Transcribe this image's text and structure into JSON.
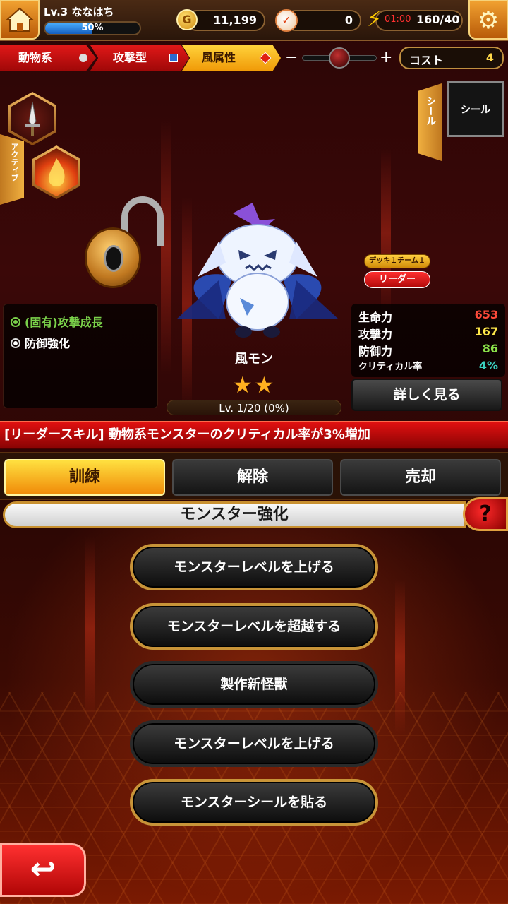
{
  "player": {
    "level_name": "Lv.3 ななはち",
    "xp_percent": 50,
    "xp_label": "50%"
  },
  "currency": {
    "gold": "11,199",
    "gold_icon": "G",
    "gems": "0",
    "stamina_timer": "01:00",
    "stamina": "160/40"
  },
  "filters": [
    {
      "label": "動物系"
    },
    {
      "label": "攻撃型"
    },
    {
      "label": "風属性"
    }
  ],
  "slider": {
    "minus": "−",
    "plus": "+",
    "level": 0.5
  },
  "cost": {
    "label": "コスト",
    "value": "4"
  },
  "side": {
    "active_label": "アクティブ",
    "seal_tab_label": "シール",
    "seal_box_label": "シール"
  },
  "skills": [
    {
      "label": "(固有)攻撃成長",
      "selected": true
    },
    {
      "label": "防御強化",
      "selected": false
    }
  ],
  "monster": {
    "name": "風モン",
    "stars": "★★",
    "level_text": "Lv. 1/20 (0%)"
  },
  "deck": {
    "badge": "デッキ１チーム１",
    "leader": "リーダー"
  },
  "stats": [
    {
      "label": "生命力",
      "value": "653",
      "color": "#ff4a3a"
    },
    {
      "label": "攻撃力",
      "value": "167",
      "color": "#ffe84a"
    },
    {
      "label": "防御力",
      "value": "86",
      "color": "#8ae04a"
    },
    {
      "label": "クリティカル率",
      "value": "4%",
      "color": "#3ad0c0"
    }
  ],
  "details_button": "詳しく見る",
  "leader_skill": "[リーダースキル] 動物系モンスターのクリティカル率が3%増加",
  "tabs": [
    {
      "label": "訓練",
      "active": true
    },
    {
      "label": "解除",
      "active": false
    },
    {
      "label": "売却",
      "active": false
    }
  ],
  "section_title": "モンスター強化",
  "help_label": "?",
  "actions": [
    {
      "label": "モンスターレベルを上げる"
    },
    {
      "label": "モンスターレベルを超越する"
    },
    {
      "label": "製作新怪獸"
    },
    {
      "label": "モンスターレベルを上げる"
    },
    {
      "label": "モンスターシールを貼る"
    }
  ],
  "back_icon": "↩"
}
